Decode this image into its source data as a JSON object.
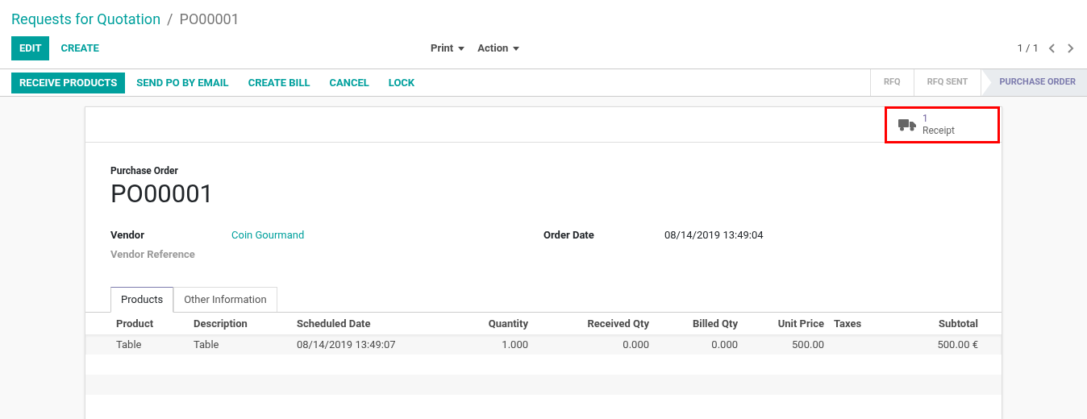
{
  "breadcrumb": [
    {
      "label": "Requests for Quotation",
      "kind": "link"
    },
    {
      "label": "PO00001",
      "kind": "current"
    }
  ],
  "separator": "/",
  "control_buttons": [
    {
      "label": "EDIT",
      "kind": "primary"
    },
    {
      "label": "CREATE",
      "kind": "secondary"
    }
  ],
  "dropdowns": [
    "Print",
    "Action"
  ],
  "pager": {
    "text": "1 / 1"
  },
  "action_buttons": [
    {
      "label": "RECEIVE PRODUCTS",
      "kind": "primary"
    },
    {
      "label": "SEND PO BY EMAIL",
      "kind": "secondary"
    },
    {
      "label": "CREATE BILL",
      "kind": "secondary"
    },
    {
      "label": "CANCEL",
      "kind": "secondary"
    },
    {
      "label": "LOCK",
      "kind": "secondary"
    }
  ],
  "status_bar": [
    {
      "label": "RFQ",
      "selected": false
    },
    {
      "label": "RFQ SENT",
      "selected": false
    },
    {
      "label": "PURCHASE ORDER",
      "selected": true
    }
  ],
  "smart_button": {
    "count": "1",
    "label": "Receipt",
    "highlighted": true
  },
  "form": {
    "subtitle": "Purchase Order",
    "title": "PO00001",
    "left_fields": [
      {
        "label": "Vendor",
        "value": "Coin Gourmand",
        "kind": "link"
      },
      {
        "label": "Vendor Reference",
        "kind": "empty"
      }
    ],
    "right_fields": [
      {
        "label": "Order Date",
        "value": "08/14/2019 13:49:04",
        "kind": "text"
      }
    ]
  },
  "tabs": [
    {
      "label": "Products",
      "selected": true
    },
    {
      "label": "Other Information",
      "selected": false
    }
  ],
  "table": {
    "columns": [
      "Product",
      "Description",
      "Scheduled Date",
      "Quantity",
      "Received Qty",
      "Billed Qty",
      "Unit Price",
      "Taxes",
      "Subtotal"
    ],
    "rows": [
      [
        "Table",
        "Table",
        "08/14/2019 13:49:07",
        "1.000",
        "0.000",
        "0.000",
        "500.00",
        "",
        "500.00 €"
      ]
    ]
  }
}
